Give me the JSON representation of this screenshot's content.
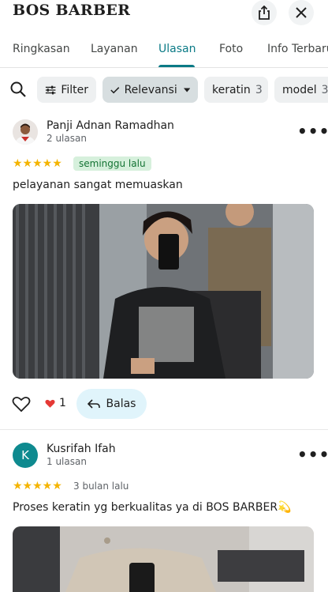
{
  "header": {
    "title": "BOS BARBER",
    "share_icon": "share-icon",
    "close_icon": "close-icon"
  },
  "tabs": [
    {
      "label": "Ringkasan",
      "active": false
    },
    {
      "label": "Layanan",
      "active": false
    },
    {
      "label": "Ulasan",
      "active": true
    },
    {
      "label": "Foto",
      "active": false
    },
    {
      "label": "Info Terbaru",
      "active": false
    }
  ],
  "filters": {
    "search_icon": "search-icon",
    "filter_label": "Filter",
    "sort_label": "Relevansi",
    "topics": [
      {
        "label": "keratin",
        "count": "3"
      },
      {
        "label": "model",
        "count": "3"
      }
    ]
  },
  "reviews": [
    {
      "name": "Panji Adnan Ramadhan",
      "review_count": "2 ulasan",
      "rating": 5,
      "stars": "★★★★★",
      "time": "seminggu lalu",
      "text": "pelayanan sangat memuaskan",
      "likes": "1",
      "reply_label": "Balas"
    },
    {
      "name": "Kusrifah Ifah",
      "avatar_letter": "K",
      "review_count": "1 ulasan",
      "rating": 5,
      "stars": "★★★★★",
      "time": "3 bulan lalu",
      "text": "Proses keratin yg berkualitas ya di BOS BARBER💫"
    }
  ],
  "colors": {
    "accent": "#0b7a86",
    "star": "#f4b400",
    "badge_bg": "#d6f0dc",
    "badge_text": "#137333",
    "reply_bg": "#e0f4fb"
  }
}
